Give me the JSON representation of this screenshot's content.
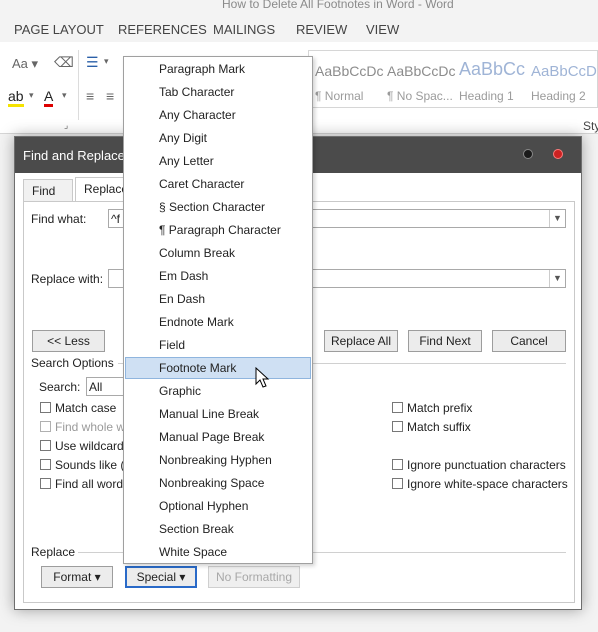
{
  "window_title": "How to Delete All Footnotes in Word - Word",
  "ribbon_tabs": [
    "PAGE LAYOUT",
    "REFERENCES",
    "MAILINGS",
    "REVIEW",
    "VIEW"
  ],
  "ribbon": {
    "font_size_label": "Aa",
    "styles": [
      {
        "preview": "AaBbCcDc",
        "name": "¶ Normal"
      },
      {
        "preview": "AaBbCcDc",
        "name": "¶ No Spac..."
      },
      {
        "preview": "AaBbCc",
        "name": "Heading 1"
      },
      {
        "preview": "AaBbCcD",
        "name": "Heading 2"
      }
    ],
    "styles_group_label": "Sty"
  },
  "dialog": {
    "title": "Find and Replace",
    "tabs": [
      "Find",
      "Replace"
    ],
    "find_what_label": "Find what:",
    "find_what_value": "^f",
    "replace_with_label": "Replace with:",
    "replace_with_value": "",
    "less_button": "<< Less",
    "replace_all_button": "Replace All",
    "find_next_button": "Find Next",
    "cancel_button": "Cancel",
    "search_options_label": "Search Options",
    "search_label": "Search:",
    "search_value": "All",
    "options_left": [
      {
        "label": "Match case",
        "disabled": false
      },
      {
        "label": "Find whole w",
        "disabled": true
      },
      {
        "label": "Use wildcards",
        "disabled": false
      },
      {
        "label": "Sounds like (",
        "disabled": false
      },
      {
        "label": "Find all word",
        "disabled": false
      }
    ],
    "options_right": [
      "Match prefix",
      "Match suffix",
      "Ignore punctuation characters",
      "Ignore white-space characters"
    ],
    "replace_section_label": "Replace",
    "format_button": "Format",
    "special_button": "Special",
    "no_formatting_button": "No Formatting"
  },
  "special_menu": {
    "items": [
      "Paragraph Mark",
      "Tab Character",
      "Any Character",
      "Any Digit",
      "Any Letter",
      "Caret Character",
      "§ Section Character",
      "¶ Paragraph Character",
      "Column Break",
      "Em Dash",
      "En Dash",
      "Endnote Mark",
      "Field",
      "Footnote Mark",
      "Graphic",
      "Manual Line Break",
      "Manual Page Break",
      "Nonbreaking Hyphen",
      "Nonbreaking Space",
      "Optional Hyphen",
      "Section Break",
      "White Space"
    ],
    "selected_item": "Footnote Mark"
  }
}
